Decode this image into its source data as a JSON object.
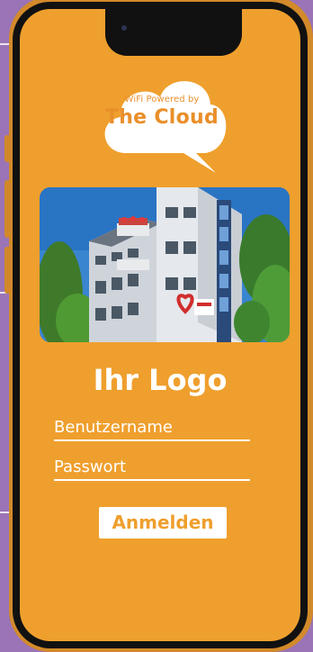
{
  "brand": {
    "small_text": "WiFi Powered by",
    "name": "The Cloud"
  },
  "login_form": {
    "logo_text": "Ihr Logo",
    "username_placeholder": "Benutzername",
    "password_placeholder": "Passwort",
    "submit_label": "Anmelden"
  },
  "colors": {
    "background": "#9a74b6",
    "phone_frame": "#d28a2a",
    "screen": "#ef9f2d",
    "accent": "#e98f2a",
    "text": "#ffffff"
  }
}
